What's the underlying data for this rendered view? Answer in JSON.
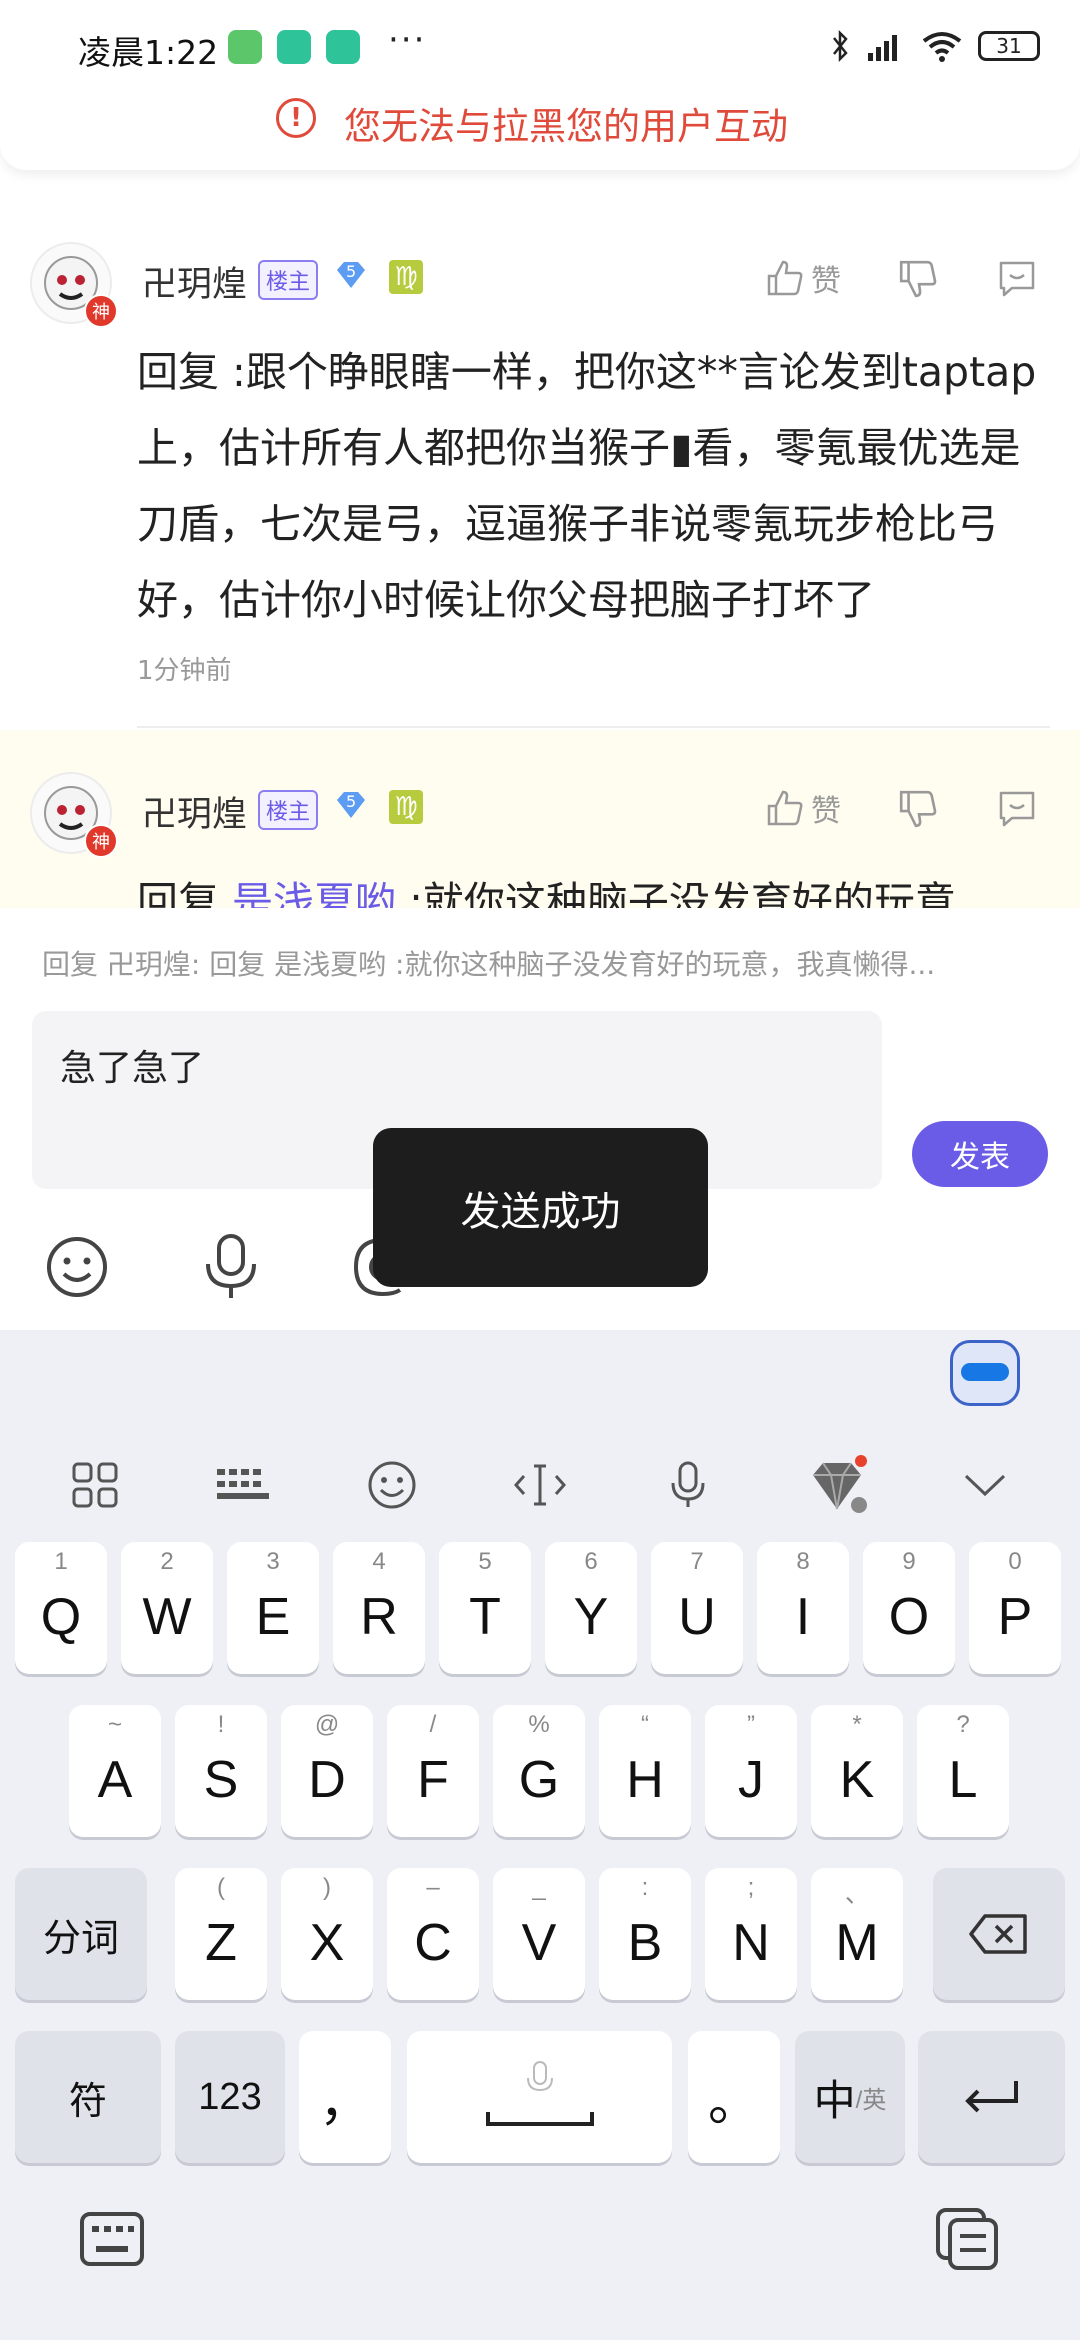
{
  "status_bar": {
    "time": "凌晨1:22",
    "more": "···",
    "battery": "31"
  },
  "notice": {
    "text": "您无法与拉黑您的用户互动"
  },
  "comments": [
    {
      "username": "卍玥煌",
      "owner_tag": "楼主",
      "level": "5",
      "avatar_badge": "神",
      "zodiac": "♍",
      "like_label": "赞",
      "body": "回复 :跟个睁眼瞎一样，把你这**言论发到taptap上，估计所有人都把你当猴子▮看，零氪最优选是刀盾，七次是弓，逗逼猴子非说零氪玩步枪比弓好，估计你小时候让你父母把脑子打坏了",
      "time": "1分钟前"
    },
    {
      "username": "卍玥煌",
      "owner_tag": "楼主",
      "level": "5",
      "avatar_badge": "神",
      "zodiac": "♍",
      "like_label": "赞",
      "body_prefix": "回复 ",
      "body_link": "是浅夏哟",
      "body_suffix": " :就你这种脑子没发育好的玩意"
    }
  ],
  "reply": {
    "preview": "回复 卍玥煌: 回复 是浅夏哟 :就你这种脑子没发育好的玩意，我真懒得...",
    "input_text": "急了急了",
    "send_label": "发表"
  },
  "toast": "发送成功",
  "keyboard": {
    "row1": [
      {
        "hint": "1",
        "key": "Q"
      },
      {
        "hint": "2",
        "key": "W"
      },
      {
        "hint": "3",
        "key": "E"
      },
      {
        "hint": "4",
        "key": "R"
      },
      {
        "hint": "5",
        "key": "T"
      },
      {
        "hint": "6",
        "key": "Y"
      },
      {
        "hint": "7",
        "key": "U"
      },
      {
        "hint": "8",
        "key": "I"
      },
      {
        "hint": "9",
        "key": "O"
      },
      {
        "hint": "0",
        "key": "P"
      }
    ],
    "row2": [
      {
        "hint": "~",
        "key": "A"
      },
      {
        "hint": "!",
        "key": "S"
      },
      {
        "hint": "@",
        "key": "D"
      },
      {
        "hint": "/",
        "key": "F"
      },
      {
        "hint": "%",
        "key": "G"
      },
      {
        "hint": "“",
        "key": "H"
      },
      {
        "hint": "”",
        "key": "J"
      },
      {
        "hint": "*",
        "key": "K"
      },
      {
        "hint": "?",
        "key": "L"
      }
    ],
    "row3": [
      {
        "hint": "(",
        "key": "Z"
      },
      {
        "hint": ")",
        "key": "X"
      },
      {
        "hint": "–",
        "key": "C"
      },
      {
        "hint": "_",
        "key": "V"
      },
      {
        "hint": ":",
        "key": "B"
      },
      {
        "hint": ";",
        "key": "N"
      },
      {
        "hint": "、",
        "key": "M"
      }
    ],
    "segment_label": "分词",
    "symbol_label": "符",
    "numeric_label": "123",
    "comma_label": "，",
    "period_label": "。",
    "lang_label": "中",
    "lang_alt_label": "/英"
  }
}
